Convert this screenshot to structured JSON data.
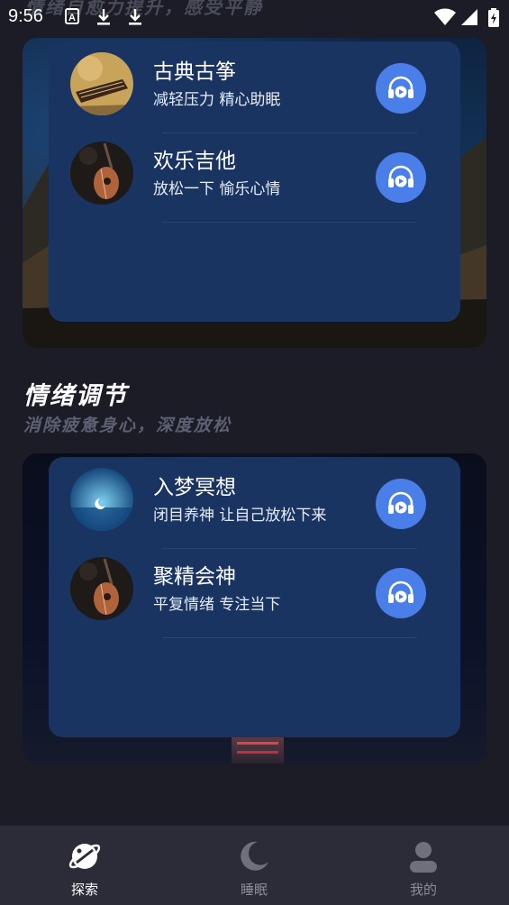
{
  "status_bar": {
    "time": "9:56",
    "icons": [
      "a-notification-icon",
      "download-icon",
      "download-icon",
      "wifi-icon",
      "signal-icon",
      "battery-charging-icon"
    ]
  },
  "header": {
    "subtitle": "情绪自愈力提升，感受平静"
  },
  "section1": {
    "tracks": [
      {
        "title": "古典古筝",
        "desc": "减轻压力 精心助眠",
        "thumb": "guzheng-thumb",
        "action": "headphones-play-icon"
      },
      {
        "title": "欢乐吉他",
        "desc": "放松一下 愉乐心情",
        "thumb": "guitar-thumb",
        "action": "headphones-play-icon"
      }
    ]
  },
  "section2": {
    "title": "情绪调节",
    "subtitle": "消除疲惫身心，深度放松",
    "tracks": [
      {
        "title": "入梦冥想",
        "desc": "闭目养神 让自己放松下来",
        "thumb": "moon-lake-thumb",
        "action": "headphones-play-icon"
      },
      {
        "title": "聚精会神",
        "desc": "平复情绪 专注当下",
        "thumb": "guitar-thumb",
        "action": "headphones-play-icon"
      }
    ]
  },
  "bottom_nav": {
    "items": [
      {
        "label": "探索",
        "icon": "planet-icon",
        "active": true
      },
      {
        "label": "睡眠",
        "icon": "moon-icon",
        "active": false
      },
      {
        "label": "我的",
        "icon": "user-icon",
        "active": false
      }
    ]
  },
  "colors": {
    "background": "#1b1c26",
    "panel": "#1a3462",
    "accent": "#4a7ee8",
    "nav_bar": "#2b2c38"
  }
}
